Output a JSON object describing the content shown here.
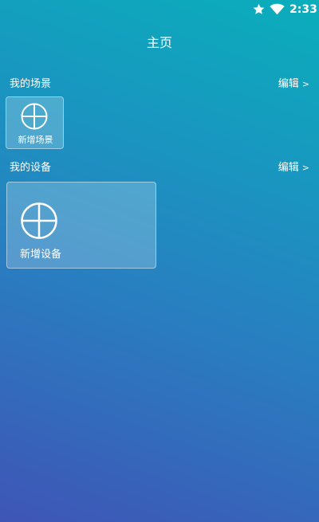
{
  "status_bar": {
    "time": "2:33",
    "icons": [
      "star-icon",
      "wifi-icon"
    ]
  },
  "header": {
    "title": "主页"
  },
  "scenes_section": {
    "title": "我的场景",
    "edit_label": "编辑",
    "edit_chevron": ">",
    "add_card": {
      "icon": "plus-circle-icon",
      "label": "新增场景"
    }
  },
  "devices_section": {
    "title": "我的设备",
    "edit_label": "编辑",
    "edit_chevron": ">",
    "add_card": {
      "icon": "plus-circle-icon",
      "label": "新增设备"
    }
  },
  "colors": {
    "gradient_top": "#0aaebb",
    "gradient_bottom": "#3f55b6",
    "text": "#ffffff"
  }
}
